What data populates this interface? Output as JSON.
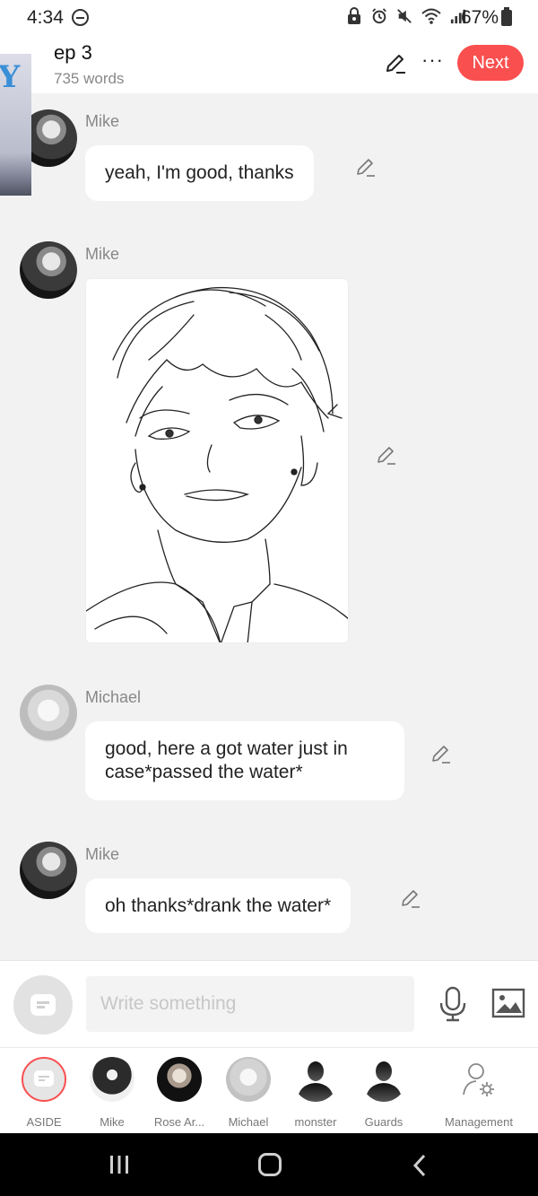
{
  "status_bar": {
    "time": "4:34",
    "battery": "67%"
  },
  "header": {
    "title": "ep 3",
    "word_count": "735 words",
    "next_label": "Next",
    "thumb_text": "Y"
  },
  "messages": [
    {
      "sender": "Mike",
      "text": "yeah, I'm good, thanks"
    },
    {
      "sender": "Mike",
      "type": "image"
    },
    {
      "sender": "Michael",
      "text": "good, here a got water just in case*passed the water*"
    },
    {
      "sender": "Mike",
      "text": "oh thanks*drank the water*"
    }
  ],
  "input": {
    "placeholder": "Write something"
  },
  "characters": [
    {
      "label": "ASIDE"
    },
    {
      "label": "Mike"
    },
    {
      "label": "Rose Ar..."
    },
    {
      "label": "Michael"
    },
    {
      "label": "monster"
    },
    {
      "label": "Guards"
    },
    {
      "label": "Management"
    }
  ],
  "colors": {
    "accent": "#fa4f4f",
    "background": "#f2f2f2",
    "bubble": "#ffffff"
  }
}
